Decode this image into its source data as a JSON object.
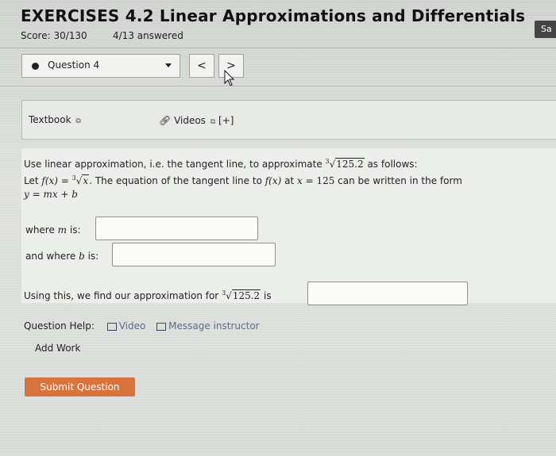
{
  "header": {
    "title_prefix": "EXERCISES 4.2",
    "title_rest": "Linear Approximations and Differentials",
    "score": "Score: 30/130",
    "answered": "4/13 answered",
    "save_label": "Sa"
  },
  "question_nav": {
    "selected": "Question 4",
    "prev": "<",
    "next": ">"
  },
  "tabs": {
    "textbook": "Textbook",
    "videos": "Videos",
    "videos_extra": "[+]"
  },
  "problem": {
    "line1_pre": "Use linear approximation, i.e. the tangent line, to approximate ",
    "root_index": "3",
    "root_value": "125.2",
    "line1_post": " as follows:",
    "line2_a": "Let ",
    "f_of_x": "f(x)",
    "eq": " = ",
    "root_x": "x",
    "line2_b": ". The equation of the tangent line to ",
    "line2_c": " at ",
    "x_var": "x",
    "x_val": "125",
    "line2_d": " can be written in the form",
    "form": "y = mx + b",
    "where_m_pre": "where ",
    "m_var": "m",
    "where_m_post": " is:",
    "where_b_pre": "and where ",
    "b_var": "b",
    "where_b_post": " is:",
    "using_pre": "Using this, we find our approximation for ",
    "using_post": " is"
  },
  "inputs": {
    "m_value": "",
    "b_value": "",
    "approx_value": ""
  },
  "help": {
    "label": "Question Help:",
    "video": "Video",
    "message": "Message instructor"
  },
  "add_work": "Add Work",
  "submit": "Submit Question"
}
